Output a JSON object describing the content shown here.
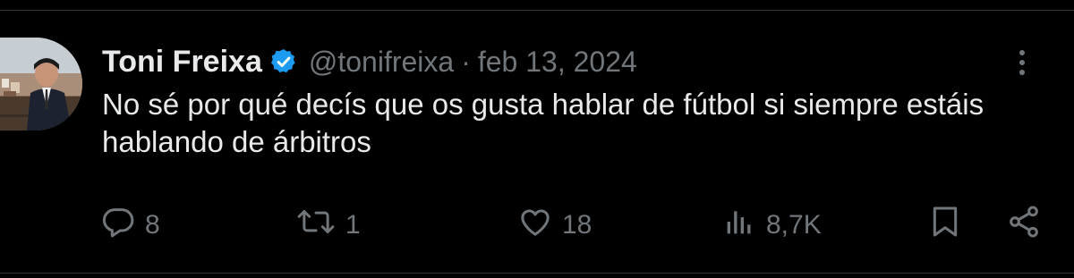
{
  "tweet": {
    "author_name": "Toni Freixa",
    "verified": true,
    "handle": "@tonifreixa",
    "separator": "·",
    "date": "feb 13, 2024",
    "text": "No sé por qué decís que os gusta hablar de fútbol si siempre estáis hablando de árbitros"
  },
  "actions": {
    "replies": "8",
    "retweets": "1",
    "likes": "18",
    "views": "8,7K"
  },
  "icons": {
    "reply": "reply-icon",
    "retweet": "retweet-icon",
    "like": "heart-icon",
    "views": "views-icon",
    "bookmark": "bookmark-icon",
    "share": "share-icon",
    "more": "more-icon",
    "verified": "verified-badge-icon"
  },
  "colors": {
    "background": "#000000",
    "text": "#e7e9ea",
    "muted": "#71767b",
    "verified": "#1d9bf0"
  }
}
